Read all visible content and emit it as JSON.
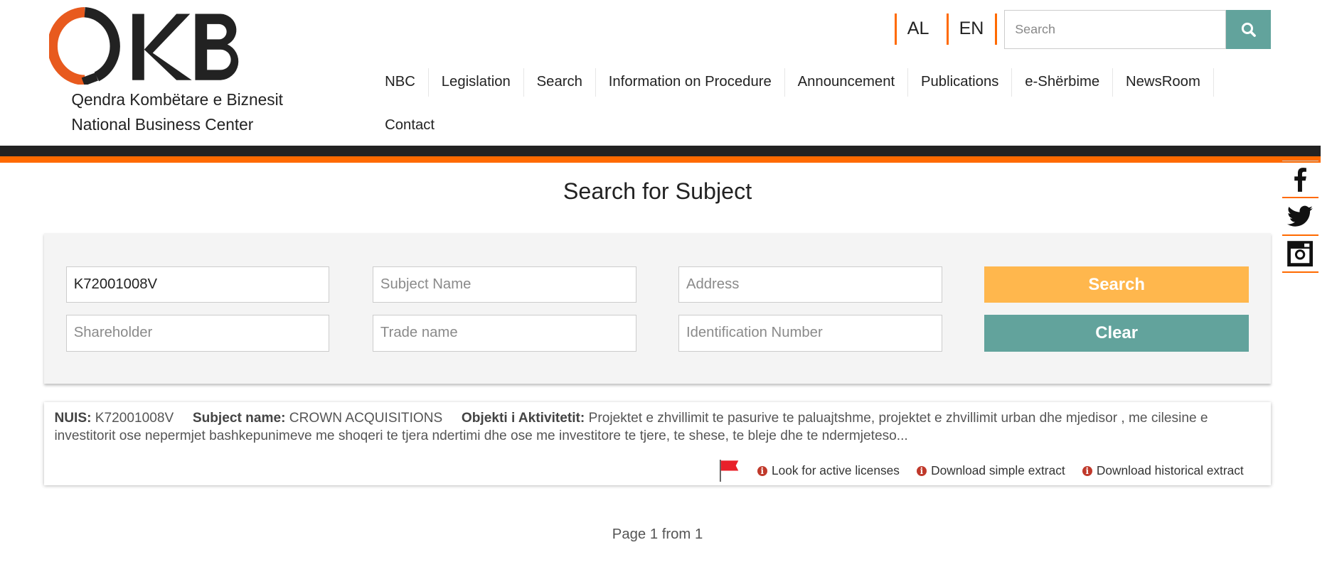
{
  "header": {
    "logo_text": "OKB",
    "org_name_sq": "Qendra Kombëtare e Biznesit",
    "org_name_en": "National Business Center",
    "languages": [
      "AL",
      "EN"
    ],
    "search_placeholder": "Search",
    "search_icon": "search-icon"
  },
  "nav": {
    "items": [
      "NBC",
      "Legislation",
      "Search",
      "Information on Procedure",
      "Announcement",
      "Publications",
      "e-Shërbime",
      "NewsRoom"
    ],
    "second_row": "Contact"
  },
  "social": [
    "facebook-icon",
    "twitter-icon",
    "instagram-icon"
  ],
  "page_title": "Search for Subject",
  "form": {
    "nuis_value": "K72001008V",
    "subject_name_placeholder": "Subject Name",
    "address_placeholder": "Address",
    "shareholder_placeholder": "Shareholder",
    "trade_name_placeholder": "Trade name",
    "identification_placeholder": "Identification Number",
    "search_label": "Search",
    "clear_label": "Clear"
  },
  "result": {
    "nuis_label": "NUIS:",
    "nuis": "K72001008V",
    "subject_label": "Subject name:",
    "subject": "CROWN ACQUISITIONS",
    "activity_label": "Objekti i Aktivitetit:",
    "activity": "Projektet e zhvillimit te pasurive te paluajtshme, projektet e zhvillimit urban dhe mjedisor , me cilesine e investitorit ose nepermjet bashkepunimeve me shoqeri te tjera ndertimi dhe ose me investitore te tjere, te shese, te bleje dhe te ndermjeteso...",
    "links": [
      "Look for active licenses",
      "Download simple extract",
      "Download historical extract"
    ]
  },
  "pagination": "Page 1 from 1",
  "colors": {
    "orange": "#ff6a00",
    "teal": "#62a39c",
    "search_button": "#ffb74d",
    "flag": "#e8202a"
  }
}
